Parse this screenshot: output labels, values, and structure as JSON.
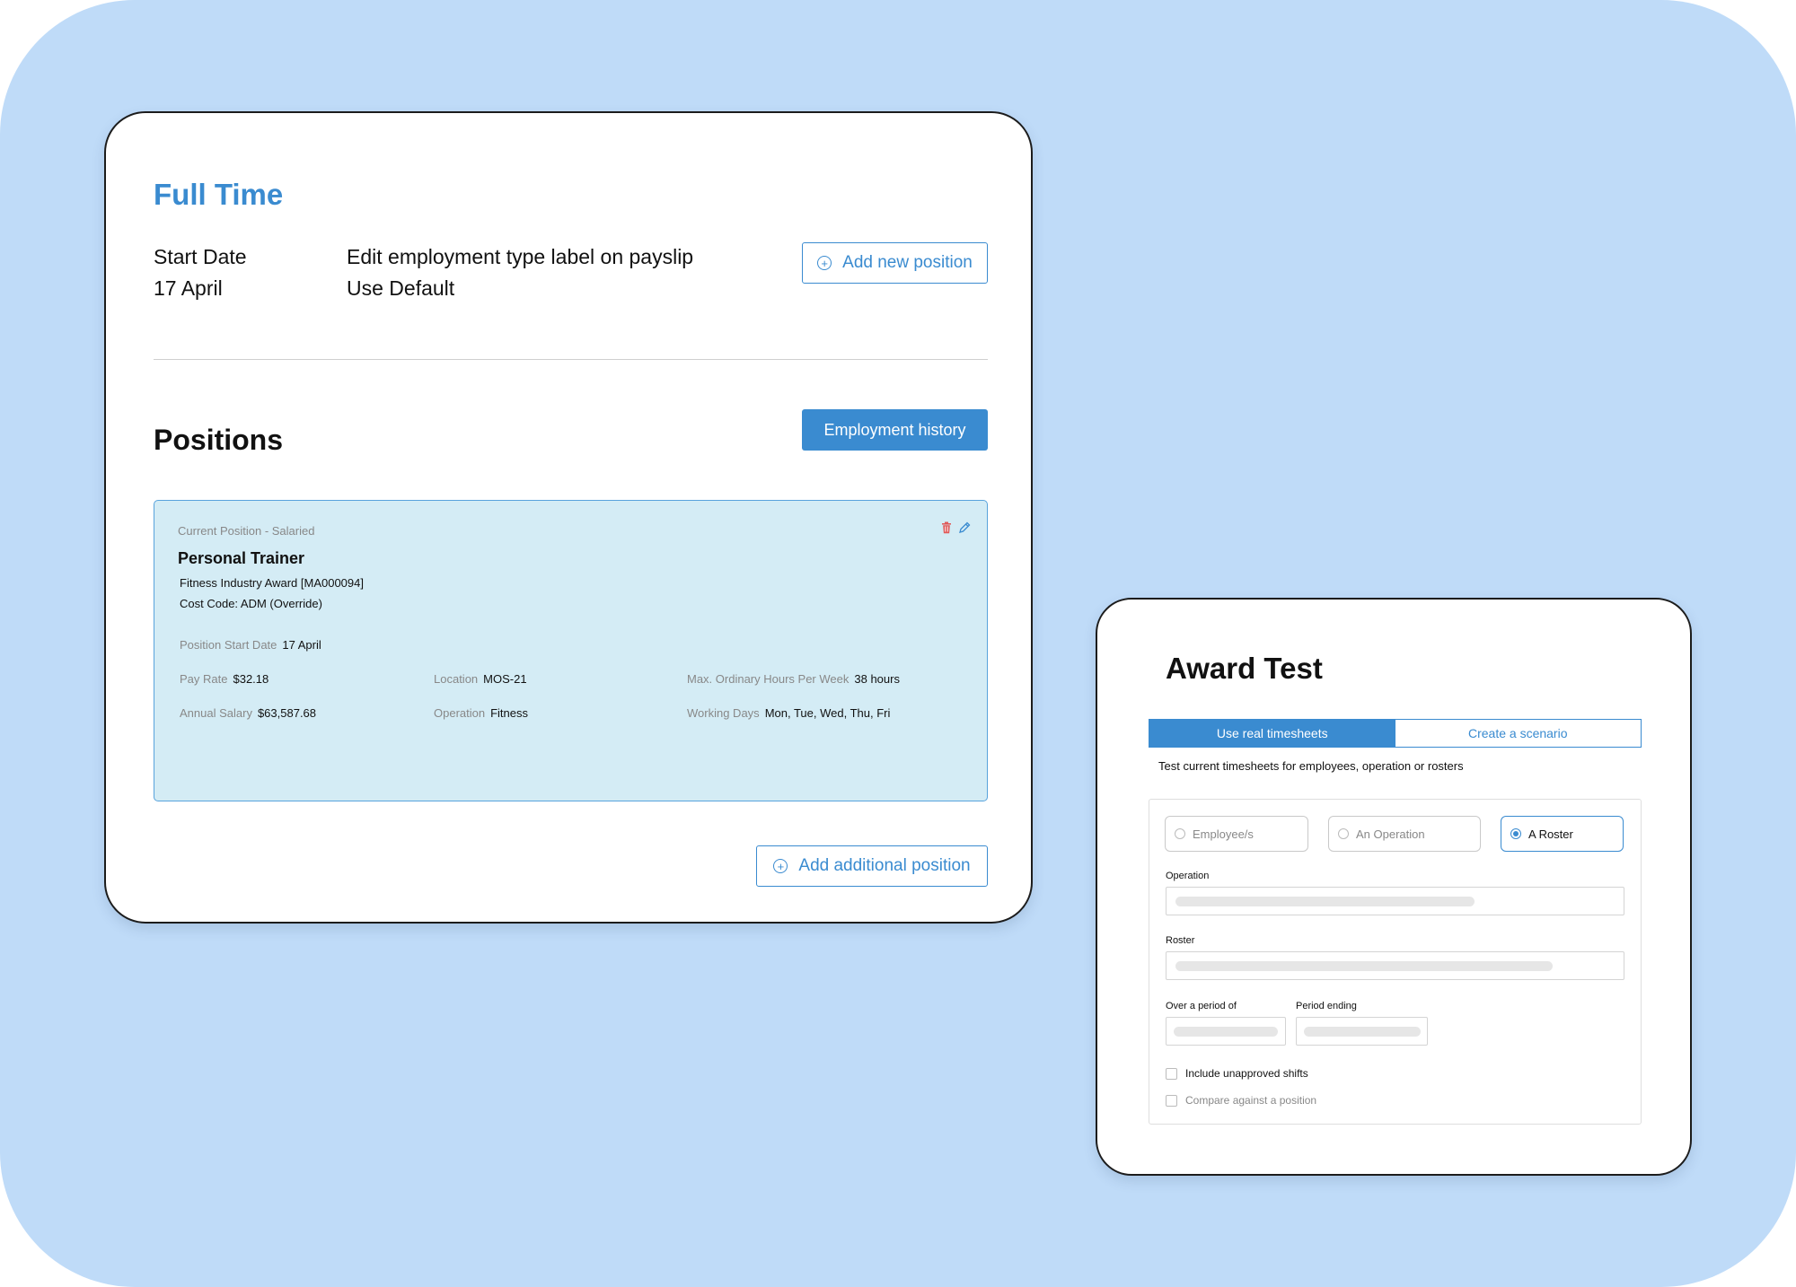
{
  "employment": {
    "type_title": "Full Time",
    "start_date_label": "Start Date",
    "start_date_value": "17 April",
    "payslip_label": "Edit employment type label on payslip",
    "payslip_value": "Use Default",
    "add_new_position_label": "Add new position"
  },
  "positions": {
    "title": "Positions",
    "history_button": "Employment history",
    "add_additional_label": "Add additional position",
    "current": {
      "header": "Current Position - Salaried",
      "title": "Personal Trainer",
      "award": "Fitness Industry Award [MA000094]",
      "cost_code": "Cost Code: ADM (Override)",
      "start_date_label": "Position Start Date",
      "start_date_value": "17 April",
      "pay_rate_label": "Pay Rate",
      "pay_rate_value": "$32.18",
      "location_label": "Location",
      "location_value": "MOS-21",
      "max_hours_label": "Max. Ordinary Hours Per Week",
      "max_hours_value": "38 hours",
      "salary_label": "Annual Salary",
      "salary_value": "$63,587.68",
      "operation_label": "Operation",
      "operation_value": "Fitness",
      "working_days_label": "Working Days",
      "working_days_value": "Mon, Tue, Wed, Thu, Fri"
    }
  },
  "award_test": {
    "title": "Award Test",
    "tabs": [
      {
        "label": "Use real timesheets",
        "active": true
      },
      {
        "label": "Create a scenario",
        "active": false
      }
    ],
    "description": "Test current timesheets for employees, operation or rosters",
    "radio_options": [
      {
        "label": "Employee/s",
        "selected": false
      },
      {
        "label": "An Operation",
        "selected": false
      },
      {
        "label": "A Roster",
        "selected": true
      }
    ],
    "operation_label": "Operation",
    "roster_label": "Roster",
    "period_label": "Over a period of",
    "period_ending_label": "Period ending",
    "include_unapproved": "Include unapproved shifts",
    "compare_position": "Compare against a position"
  },
  "colors": {
    "accent": "#3a8bd0",
    "background": "#bfdbf8",
    "position_card": "#d4ecf5",
    "delete": "#e05a5a"
  }
}
